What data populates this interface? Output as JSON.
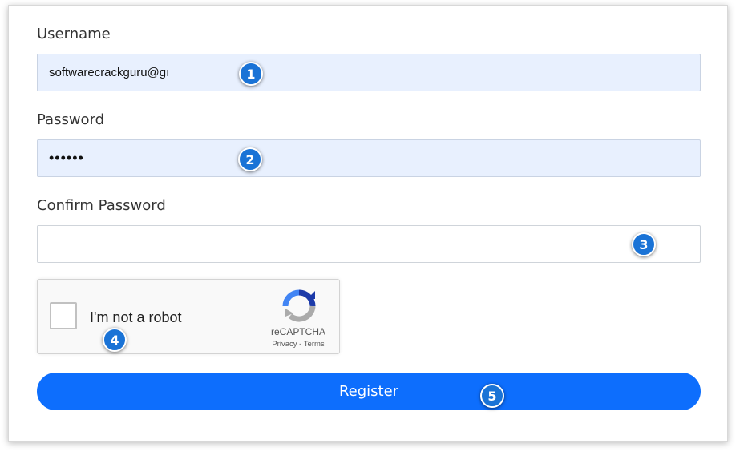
{
  "form": {
    "username": {
      "label": "Username",
      "value": "softwarecrackguru@gı"
    },
    "password": {
      "label": "Password",
      "value": "••••••"
    },
    "confirm_password": {
      "label": "Confirm Password",
      "value": ""
    },
    "captcha": {
      "label": "I'm not a robot",
      "brand": "reCAPTCHA",
      "privacy": "Privacy",
      "separator": "-",
      "terms": "Terms",
      "checked": false
    },
    "register_label": "Register"
  },
  "annotations": [
    "1",
    "2",
    "3",
    "4",
    "5"
  ],
  "colors": {
    "accent": "#0d6efd",
    "badge": "#1a73d6",
    "autofill_bg": "#e8f0fe"
  }
}
